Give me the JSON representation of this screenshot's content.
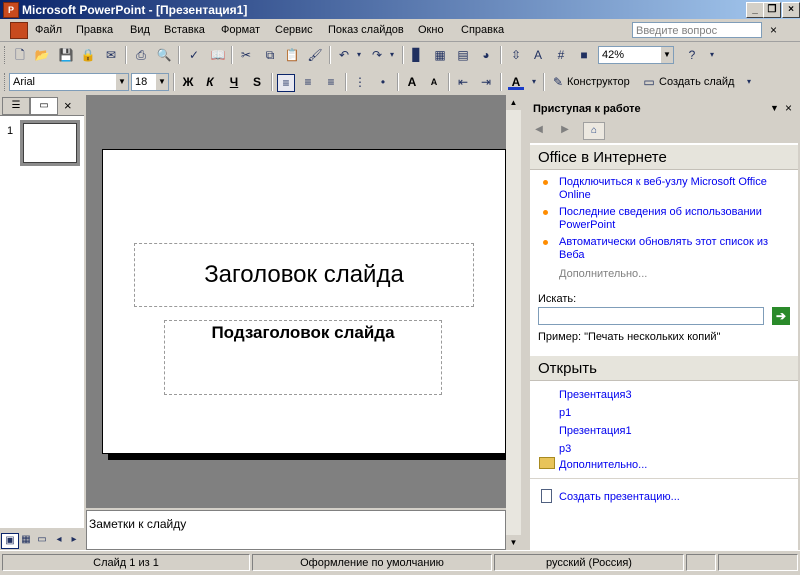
{
  "window": {
    "title": "Microsoft PowerPoint - [Презентация1]"
  },
  "menu": {
    "items": [
      "Файл",
      "Правка",
      "Вид",
      "Вставка",
      "Формат",
      "Сервис",
      "Показ слайдов",
      "Окно",
      "Справка"
    ],
    "help_placeholder": "Введите вопрос"
  },
  "toolbar": {
    "zoom": "42%",
    "font": "Arial",
    "font_size": "18",
    "designer": "Конструктор",
    "new_slide": "Создать слайд"
  },
  "outline": {
    "slide_number": "1"
  },
  "slide": {
    "title": "Заголовок слайда",
    "subtitle": "Подзаголовок слайда"
  },
  "notes": {
    "text": "Заметки к слайду"
  },
  "taskpane": {
    "title": "Приступая к работе",
    "office_online": {
      "heading": "Office в Интернете",
      "links": [
        "Подключиться к веб-узлу Microsoft Office Online",
        "Последние сведения об использовании PowerPoint",
        "Автоматически обновлять этот список из Веба"
      ],
      "more": "Дополнительно..."
    },
    "search": {
      "label": "Искать:",
      "example": "Пример:  \"Печать нескольких копий\""
    },
    "open": {
      "heading": "Открыть",
      "files": [
        "Презентация3",
        "p1",
        "Презентация1",
        "p3"
      ],
      "more": "Дополнительно...",
      "create": "Создать презентацию..."
    }
  },
  "status": {
    "slide": "Слайд 1 из 1",
    "design": "Оформление по умолчанию",
    "language": "русский (Россия)"
  },
  "colors": {
    "titlebar": "#0a246a",
    "link": "#0000ee",
    "bullet": "#ff8c00",
    "canvas": "#808080"
  }
}
